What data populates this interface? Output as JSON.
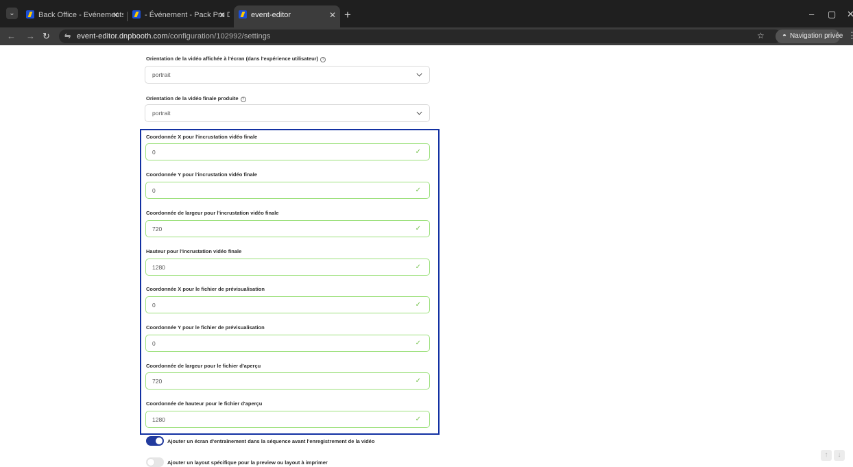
{
  "browser": {
    "tabs": [
      {
        "title": "Back Office - Evénements : Nou",
        "active": false
      },
      {
        "title": "- Événement - Pack Pro Data (E",
        "active": false
      },
      {
        "title": "event-editor",
        "active": true
      }
    ],
    "new_tab_icon": "plus-icon",
    "url_host": "event-editor.dnpbooth.com",
    "url_path": "/configuration/102992/settings",
    "incognito_label": "Navigation privée",
    "accent_color": "#1b4fd8"
  },
  "form": {
    "display_orientation": {
      "label": "Orientation de la vidéo affichée à l'écran (dans l'expérience utilisateur)",
      "value": "portrait"
    },
    "final_orientation": {
      "label": "Orientation de la vidéo finale produite",
      "value": "portrait"
    },
    "coordinates": [
      {
        "label": "Coordonnée X pour l'incrustation vidéo finale",
        "value": "0"
      },
      {
        "label": "Coordonnée Y pour l'incrustation vidéo finale",
        "value": "0"
      },
      {
        "label": "Coordonnée de largeur pour l'incrustation vidéo finale",
        "value": "720"
      },
      {
        "label": "Hauteur pour l'incrustation vidéo finale",
        "value": "1280"
      },
      {
        "label": "Coordonnée X pour le fichier de prévisualisation",
        "value": "0"
      },
      {
        "label": "Coordonnée Y pour le fichier de prévisualisation",
        "value": "0"
      },
      {
        "label": "Coordonnée de largeur pour le fichier d'aperçu",
        "value": "720"
      },
      {
        "label": "Coordonnée de hauteur pour le fichier d'aperçu",
        "value": "1280"
      }
    ],
    "toggles": [
      {
        "label": "Ajouter un écran d'entraînement dans la séquence avant l'enregistrement de la vidéo",
        "on": true
      },
      {
        "label": "Ajouter un layout spécifique pour la preview ou layout à imprimer",
        "on": false
      }
    ],
    "valid_color": "#9be07a",
    "highlight_color": "#1230a2"
  }
}
